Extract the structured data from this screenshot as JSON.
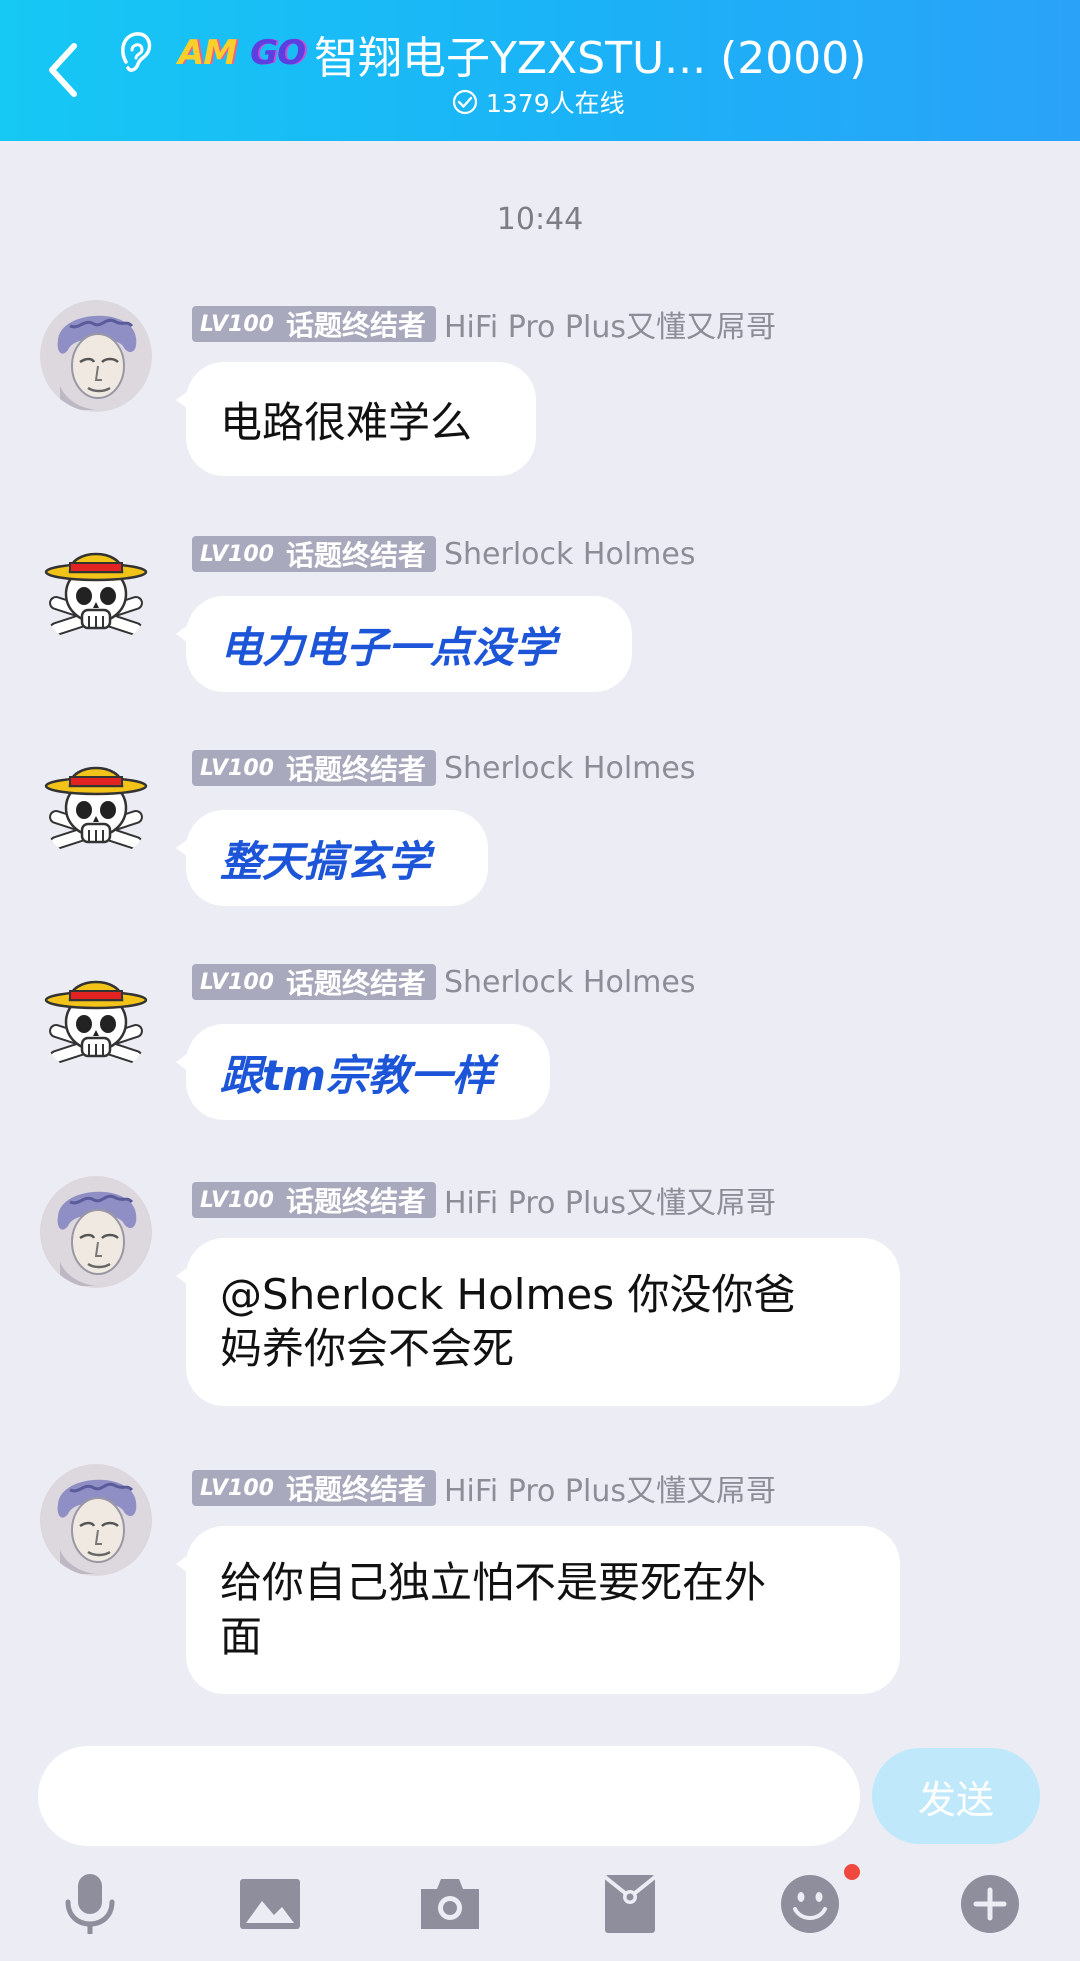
{
  "header": {
    "brand_am": "AM",
    "brand_go": "GO",
    "title": "智翔电子YZXSTU... (2000)",
    "online": "1379人在线"
  },
  "time": "10:44",
  "badge": {
    "level": "LV100",
    "title": "话题终结者"
  },
  "messages": [
    {
      "sender": "HiFi Pro Plus又懂又屌哥",
      "avatar": "portrait-avatar",
      "text": "电路很难学么",
      "style": "normal"
    },
    {
      "sender": "Sherlock Holmes",
      "avatar": "skull-avatar",
      "text": "电力电子一点没学",
      "style": "blue"
    },
    {
      "sender": "Sherlock Holmes",
      "avatar": "skull-avatar",
      "text": "整天搞玄学",
      "style": "blue"
    },
    {
      "sender": "Sherlock Holmes",
      "avatar": "skull-avatar",
      "text": "跟tm宗教一样",
      "style": "blue"
    },
    {
      "sender": "HiFi Pro Plus又懂又屌哥",
      "avatar": "portrait-avatar",
      "line1": "@Sherlock Holmes 你没你爸",
      "line2": "妈养你会不会死",
      "style": "normal"
    },
    {
      "sender": "HiFi Pro Plus又懂又屌哥",
      "avatar": "portrait-avatar",
      "line1": "给你自己独立怕不是要死在外",
      "line2": "面",
      "style": "normal"
    }
  ],
  "input": {
    "placeholder": "",
    "send_label": "发送"
  },
  "toolbar": [
    "microphone-icon",
    "image-icon",
    "camera-icon",
    "redpacket-icon",
    "emoji-icon",
    "plus-icon"
  ],
  "colors": {
    "header_start": "#16c8f4",
    "header_end": "#2aa2f8",
    "bubble_blue_text": "#1d55d8",
    "send_bg": "#bfe9fb",
    "badge_bg": "#a9a9bd"
  }
}
